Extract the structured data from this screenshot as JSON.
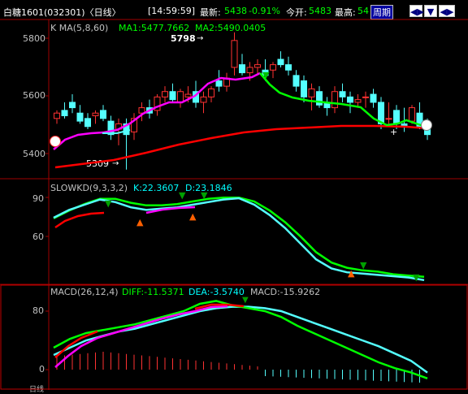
{
  "header": {
    "symbol": "白糖1601",
    "code_period": "(032301)〈日线〉",
    "time": "[14:59:59]",
    "last_label": "最新:",
    "last_value": "5438",
    "change": "-0.91%",
    "open_label": "今开:",
    "open_value": "5483",
    "high_label": "最高:",
    "high_value": "54",
    "period_label": "周期",
    "buttons": [
      "◀▶",
      "▼",
      "◀▶"
    ]
  },
  "main_panel": {
    "indicator_name": "K  MA(5,8,60)",
    "ma1": "MA1:5477.7662",
    "ma2": "MA2:5490.0405",
    "yticks": [
      "5800",
      "5600",
      "5400"
    ],
    "annotation_high": "5798",
    "annotation_low": "5309",
    "colors": {
      "up": "#ff3232",
      "down": "#54ffff",
      "ma_pink": "#ff00ff",
      "ma_green": "#00ff00",
      "ma_red": "#ff0000"
    }
  },
  "kd_panel": {
    "indicator_name": "SLOWKD(9,3,3,2)",
    "k_value": "K:22.3607",
    "d_value": "D:23.1846",
    "yticks": [
      "90",
      "60"
    ]
  },
  "macd_panel": {
    "indicator_name": "MACD(26,12,4)",
    "diff": "DIFF:-11.5371",
    "dea": "DEA:-3.5740",
    "macd": "MACD:-15.9262",
    "yticks": [
      "80",
      "0"
    ]
  },
  "footer": {
    "label": "日线"
  },
  "chart_data": {
    "type": "candlestick",
    "y_range": [
      5300,
      5850
    ],
    "candles": [
      [
        5500,
        5530,
        5480,
        5520
      ],
      [
        5530,
        5560,
        5500,
        5510
      ],
      [
        5560,
        5590,
        5520,
        5540
      ],
      [
        5520,
        5550,
        5480,
        5490
      ],
      [
        5500,
        5520,
        5460,
        5470
      ],
      [
        5510,
        5530,
        5480,
        5520
      ],
      [
        5530,
        5550,
        5490,
        5500
      ],
      [
        5490,
        5510,
        5420,
        5440
      ],
      [
        5460,
        5500,
        5400,
        5480
      ],
      [
        5480,
        5500,
        5310,
        5440
      ],
      [
        5450,
        5520,
        5420,
        5500
      ],
      [
        5520,
        5560,
        5490,
        5540
      ],
      [
        5540,
        5570,
        5500,
        5520
      ],
      [
        5530,
        5590,
        5510,
        5580
      ],
      [
        5580,
        5620,
        5560,
        5600
      ],
      [
        5600,
        5630,
        5560,
        5570
      ],
      [
        5560,
        5610,
        5540,
        5600
      ],
      [
        5580,
        5620,
        5560,
        5590
      ],
      [
        5600,
        5640,
        5540,
        5560
      ],
      [
        5560,
        5600,
        5520,
        5580
      ],
      [
        5580,
        5620,
        5560,
        5610
      ],
      [
        5640,
        5680,
        5600,
        5620
      ],
      [
        5620,
        5670,
        5600,
        5650
      ],
      [
        5690,
        5820,
        5660,
        5790
      ],
      [
        5700,
        5740,
        5660,
        5670
      ],
      [
        5670,
        5710,
        5640,
        5690
      ],
      [
        5690,
        5720,
        5660,
        5700
      ],
      [
        5680,
        5720,
        5640,
        5660
      ],
      [
        5680,
        5710,
        5650,
        5700
      ],
      [
        5720,
        5750,
        5690,
        5700
      ],
      [
        5700,
        5730,
        5660,
        5680
      ],
      [
        5660,
        5680,
        5600,
        5620
      ],
      [
        5640,
        5660,
        5560,
        5580
      ],
      [
        5580,
        5630,
        5530,
        5610
      ],
      [
        5600,
        5620,
        5540,
        5550
      ],
      [
        5560,
        5580,
        5510,
        5540
      ],
      [
        5540,
        5620,
        5520,
        5600
      ],
      [
        5600,
        5630,
        5560,
        5580
      ],
      [
        5580,
        5600,
        5520,
        5560
      ],
      [
        5560,
        5590,
        5540,
        5570
      ],
      [
        5580,
        5600,
        5540,
        5580
      ],
      [
        5590,
        5610,
        5540,
        5560
      ],
      [
        5560,
        5580,
        5460,
        5480
      ],
      [
        5500,
        5560,
        5480,
        5500
      ],
      [
        5530,
        5550,
        5460,
        5480
      ],
      [
        5480,
        5540,
        5450,
        5470
      ],
      [
        5490,
        5550,
        5480,
        5540
      ],
      [
        5520,
        5560,
        5460,
        5470
      ],
      [
        5460,
        5500,
        5420,
        5440
      ]
    ],
    "kd": {
      "k": [
        70,
        76,
        80,
        84,
        82,
        78,
        76,
        77,
        78,
        80,
        82,
        84,
        85,
        80,
        72,
        62,
        50,
        38,
        31,
        28,
        27,
        26,
        25,
        24,
        22
      ],
      "d": [
        68,
        74,
        79,
        83,
        83,
        80,
        78,
        78,
        79,
        81,
        83,
        84,
        84,
        81,
        74,
        65,
        54,
        42,
        34,
        30,
        28,
        27,
        25,
        24,
        23
      ]
    },
    "macd": {
      "diff": [
        30,
        42,
        50,
        54,
        58,
        62,
        68,
        74,
        80,
        90,
        94,
        88,
        84,
        80,
        72,
        60,
        50,
        40,
        30,
        20,
        10,
        2,
        -4,
        -12
      ],
      "dea": [
        20,
        30,
        40,
        46,
        52,
        56,
        62,
        68,
        74,
        80,
        84,
        86,
        86,
        84,
        80,
        72,
        64,
        56,
        48,
        40,
        32,
        22,
        12,
        -4
      ]
    }
  }
}
